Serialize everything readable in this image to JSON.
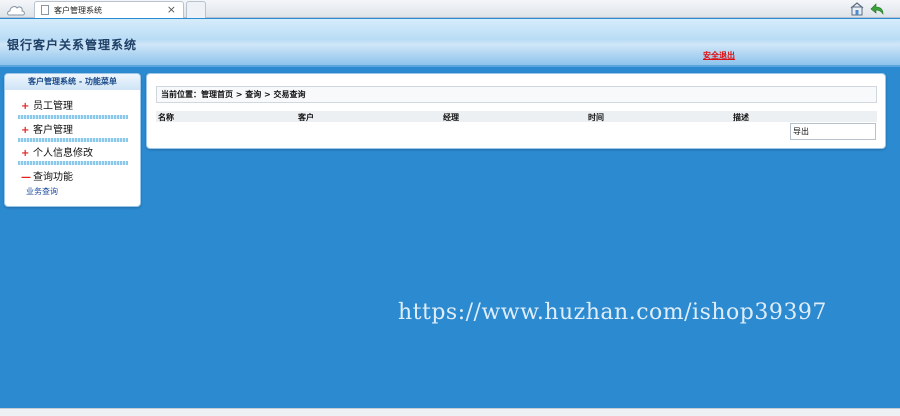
{
  "browser": {
    "tab_title": "客户管理系统",
    "tab_close": "×"
  },
  "header": {
    "system_title": "银行客户关系管理系统",
    "logout_label": "安全退出"
  },
  "menu": {
    "title": "客户管理系统 - 功能菜单",
    "items": [
      {
        "sign": "+",
        "label": "员工管理"
      },
      {
        "sign": "+",
        "label": "客户管理"
      },
      {
        "sign": "+",
        "label": "个人信息修改"
      },
      {
        "sign": "—",
        "label": "查询功能"
      }
    ],
    "sub_items": [
      "业务查询"
    ]
  },
  "content": {
    "breadcrumb": "当前位置：管理首页 > 查询 > 交易查询",
    "table_headers": [
      "名称",
      "客户",
      "经理",
      "时间",
      "描述"
    ],
    "export_label": "导出"
  },
  "watermark": "https://www.huzhan.com/ishop39397",
  "colors": {
    "background": "#2b8ad0",
    "logout": "#e01010",
    "menu_sign": "#e02020"
  }
}
